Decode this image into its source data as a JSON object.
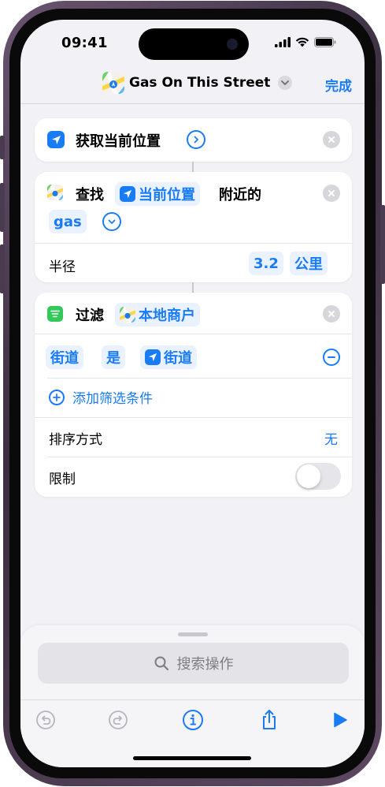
{
  "status_bar": {
    "time": "09:41"
  },
  "header": {
    "title": "Gas On This Street",
    "done_label": "完成"
  },
  "action1": {
    "label": "获取当前位置"
  },
  "action2": {
    "verb": "查找",
    "location_token": "当前位置",
    "suffix": "附近的",
    "query_token": "gas",
    "radius_label": "半径",
    "radius_value": "3.2",
    "radius_unit": "公里"
  },
  "action3": {
    "verb": "过滤",
    "source_token": "本地商户",
    "condition": {
      "field": "街道",
      "operator": "是",
      "value": "街道"
    },
    "add_filter_label": "添加筛选条件",
    "sort_label": "排序方式",
    "sort_value": "无",
    "limit_label": "限制",
    "limit_enabled": false
  },
  "search": {
    "placeholder": "搜索操作"
  },
  "toolbar": {
    "icons": [
      "undo-icon",
      "redo-icon",
      "info-icon",
      "share-icon",
      "play-icon"
    ]
  },
  "colors": {
    "accent": "#1a7cf5",
    "background": "#f2f2f6"
  }
}
